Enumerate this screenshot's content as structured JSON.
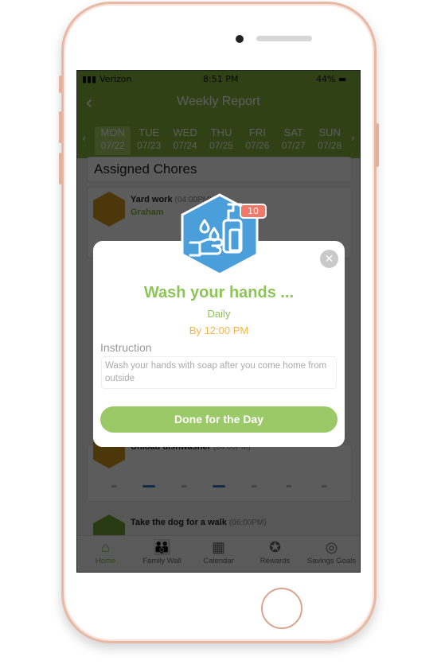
{
  "status_bar": {
    "carrier": "Verizon",
    "time": "8:51 PM",
    "battery": "44%"
  },
  "header": {
    "title": "Weekly Report"
  },
  "days": [
    {
      "day": "MON",
      "date": "07/22",
      "selected": true
    },
    {
      "day": "TUE",
      "date": "07/23"
    },
    {
      "day": "WED",
      "date": "07/24"
    },
    {
      "day": "THU",
      "date": "07/25"
    },
    {
      "day": "FRI",
      "date": "07/26"
    },
    {
      "day": "SAT",
      "date": "07/27"
    },
    {
      "day": "SUN",
      "date": "07/28"
    }
  ],
  "section_title": "Assigned Chores",
  "chores": [
    {
      "name": "Yard work",
      "time": "(04:00PM)",
      "assignee": "Graham",
      "icon": "lawn-mower-icon"
    },
    {
      "name": "Unload dishwasher",
      "time": "(04:00PM)",
      "icon": "dishwasher-icon"
    },
    {
      "name": "Take the dog for a walk",
      "time": "(06:00PM)",
      "icon": "dog-icon"
    }
  ],
  "tabs": [
    {
      "label": "Home",
      "icon": "home-icon",
      "active": true
    },
    {
      "label": "Family Wall",
      "icon": "family-icon"
    },
    {
      "label": "Calendar",
      "icon": "calendar-icon"
    },
    {
      "label": "Rewards",
      "icon": "award-icon"
    },
    {
      "label": "Savings Goals",
      "icon": "target-icon"
    }
  ],
  "modal": {
    "badge": "10",
    "title": "Wash your hands ...",
    "frequency": "Daily",
    "due": "By 12:00 PM",
    "instruction_label": "Instruction",
    "instruction": "Wash your hands with soap after you come home from outside",
    "done_label": "Done for the Day",
    "icon": "hand-wash-icon"
  },
  "colors": {
    "brand_green": "#86b83a",
    "title_green": "#8dc456",
    "due_orange": "#f3b548",
    "badge_red": "#ef7a6b",
    "icon_blue": "#4a9fdb"
  }
}
